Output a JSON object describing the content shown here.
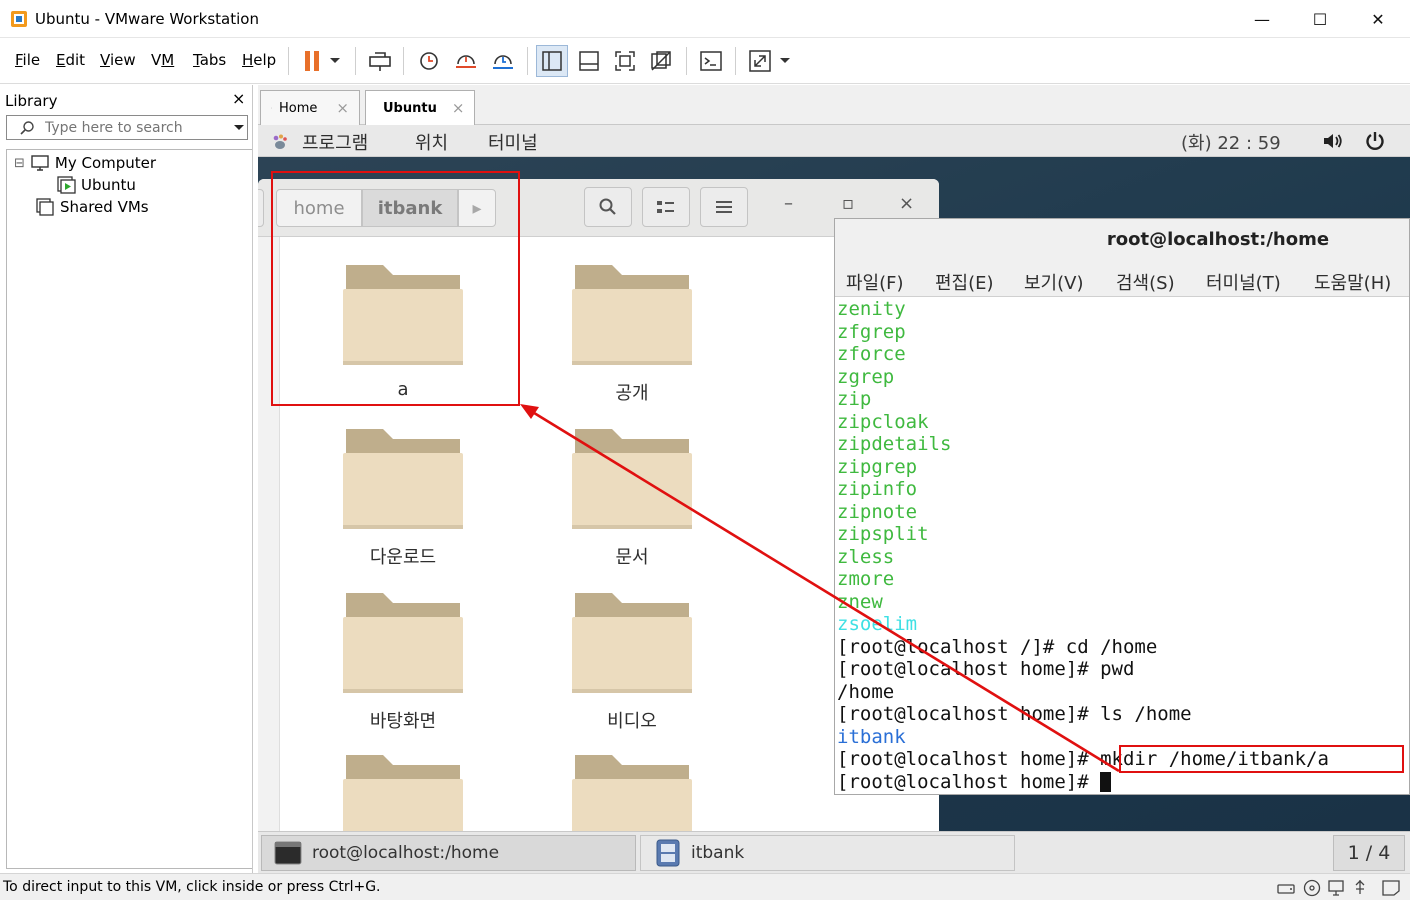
{
  "window": {
    "title": "Ubuntu - VMware Workstation",
    "minimize": "—",
    "maximize": "☐",
    "close": "✕"
  },
  "menu": {
    "file": {
      "u": "F",
      "rest": "ile"
    },
    "edit": {
      "u": "E",
      "rest": "dit"
    },
    "view": {
      "u": "V",
      "rest": "iew"
    },
    "vm": {
      "pre": "V",
      "u": "M",
      "rest": ""
    },
    "tabs": {
      "u": "T",
      "rest": "abs"
    },
    "help": {
      "u": "H",
      "rest": "elp"
    }
  },
  "library": {
    "title": "Library",
    "close": "×",
    "search_placeholder": "Type here to search",
    "tree": {
      "expander": "⊟",
      "my_computer": "My Computer",
      "ubuntu": "Ubuntu",
      "shared": "Shared VMs"
    }
  },
  "vm_tabs": {
    "home": "Home",
    "ubuntu": "Ubuntu",
    "close": "×"
  },
  "gnome": {
    "programs": "프로그램",
    "places": "위치",
    "terminal": "터미널",
    "clock": "(화) 22 : 59"
  },
  "nautilus": {
    "crumbs": [
      "home",
      "itbank"
    ],
    "next": "▸",
    "folders": [
      "a",
      "공개",
      "다운로드",
      "문서",
      "바탕화면",
      "비디오"
    ],
    "win_minimize": "–",
    "win_maximize": "▫",
    "win_close": "×"
  },
  "terminal": {
    "title": "root@localhost:/home",
    "menu": [
      "파일(F)",
      "편집(E)",
      "보기(V)",
      "검색(S)",
      "터미널(T)",
      "도움말(H)"
    ],
    "green_lines": [
      "zenity",
      "zfgrep",
      "zforce",
      "zgrep",
      "zip",
      "zipcloak",
      "zipdetails",
      "zipgrep",
      "zipinfo",
      "zipnote",
      "zipsplit",
      "zless",
      "zmore",
      "znew"
    ],
    "cyan_line": "zsoelim",
    "prompt_root": "[root@localhost /]# ",
    "prompt_home": "[root@localhost home]# ",
    "cmd_cd": "cd /home",
    "cmd_pwd": "pwd",
    "out_pwd": "/home",
    "cmd_ls": "ls /home",
    "out_ls": "itbank",
    "cmd_mkdir": "mkdir /home/itbank/a"
  },
  "taskbar": {
    "terminal_task": "root@localhost:/home",
    "files_task": "itbank",
    "workspace": "1 / 4"
  },
  "status": {
    "text": "To direct input to this VM, click inside or press Ctrl+G."
  },
  "colors": {
    "annotation_red": "#e01010",
    "pause_orange": "#e8702a",
    "term_green": "#3fb93f",
    "term_cyan": "#3fe0e4",
    "term_blue": "#2a6fd6"
  }
}
